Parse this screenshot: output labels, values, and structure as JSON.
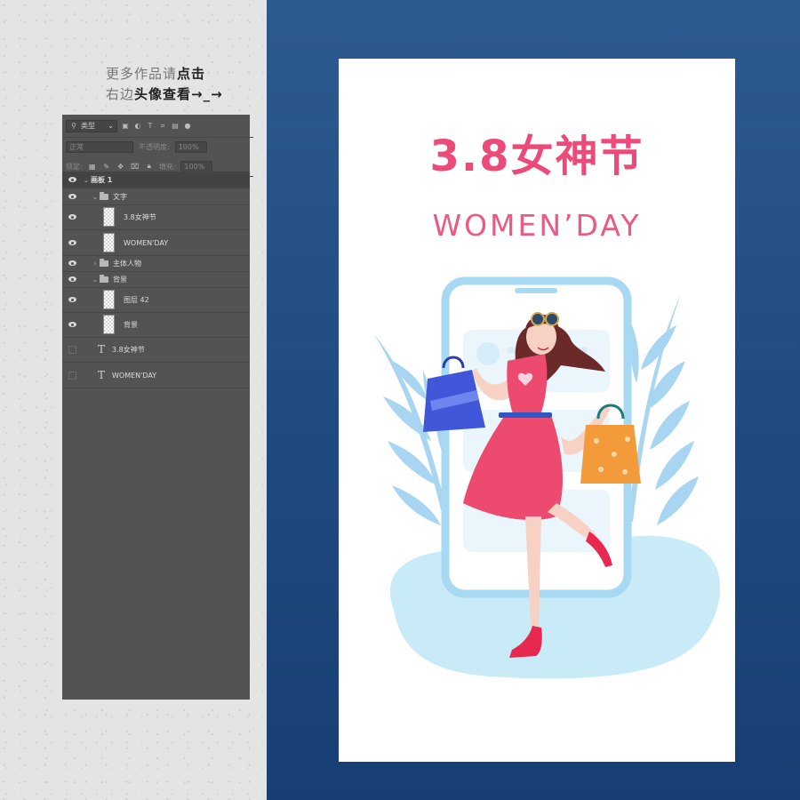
{
  "promo": {
    "line1_plain": "更多作品请",
    "line1_bold": "点击",
    "line2_plain": "右边",
    "line2_bold": "头像查看→_→"
  },
  "layers_panel": {
    "filter_label": "类型",
    "blend_mode": "正常",
    "opacity_label": "不透明度:",
    "opacity_value": "100%",
    "lock_label": "锁定:",
    "fill_label": "填充:",
    "fill_value": "100%",
    "layers": [
      {
        "name": "画板 1",
        "kind": "artboard",
        "visible": true
      },
      {
        "name": "文字",
        "kind": "group",
        "visible": true
      },
      {
        "name": "3.8女神节",
        "kind": "layer",
        "visible": true
      },
      {
        "name": "WOMEN'DAY",
        "kind": "layer",
        "visible": true
      },
      {
        "name": "主体人物",
        "kind": "group",
        "visible": true
      },
      {
        "name": "背景",
        "kind": "group",
        "visible": true
      },
      {
        "name": "图层 42",
        "kind": "layer",
        "visible": true
      },
      {
        "name": "背景",
        "kind": "layer",
        "visible": true
      },
      {
        "name": "3.8女神节",
        "kind": "text",
        "visible": false
      },
      {
        "name": "WOMEN'DAY",
        "kind": "text",
        "visible": false
      }
    ]
  },
  "poster": {
    "title": "3.8女神节",
    "subtitle": "WOMEN’DAY"
  },
  "colors": {
    "accent_pink": "#ec4a78",
    "navy": "#1f4a80",
    "panel": "#535353"
  }
}
